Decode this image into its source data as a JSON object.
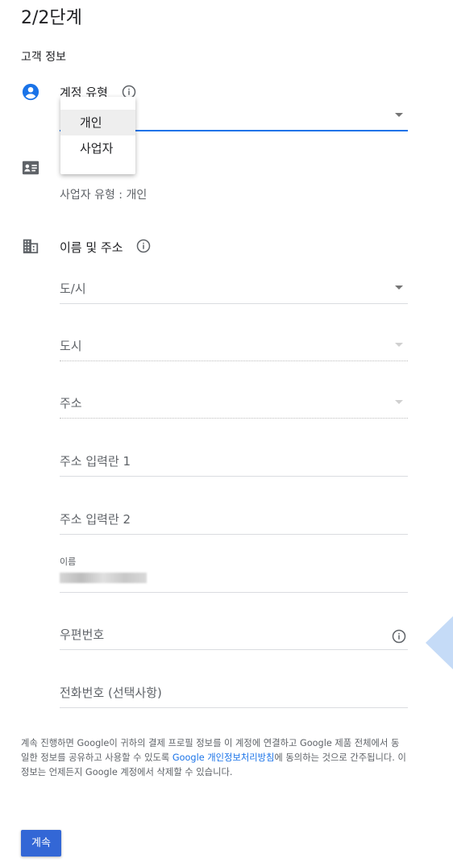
{
  "header": {
    "step": "2/2단계",
    "section": "고객 정보"
  },
  "account": {
    "label": "계정 유형",
    "options": [
      "개인",
      "사업자"
    ],
    "selected": "개인"
  },
  "business": {
    "summary": "사업자 유형 : 개인"
  },
  "address": {
    "label": "이름 및 주소",
    "province": "도/시",
    "city": "도시",
    "addr": "주소",
    "line1": "주소 입력란 1",
    "line2": "주소 입력란 2",
    "name_label": "이름",
    "postal": "우편번호",
    "phone": "전화번호 (선택사항)"
  },
  "footer": {
    "text_before": "계속 진행하면 Google이 귀하의 결제 프로필 정보를 이 계정에 연결하고 Google 제품 전체에서 동일한 정보를 공유하고 사용할 수 있도록 ",
    "link": "Google 개인정보처리방침",
    "text_after": "에 동의하는 것으로 간주됩니다. 이 정보는 언제든지 Google 계정에서 삭제할 수 있습니다."
  },
  "continue_button": "계속",
  "colors": {
    "primary": "#1a73e8",
    "button": "#3367d6"
  },
  "icons": [
    "account-circle-icon",
    "info-icon",
    "business-card-icon",
    "building-icon"
  ]
}
